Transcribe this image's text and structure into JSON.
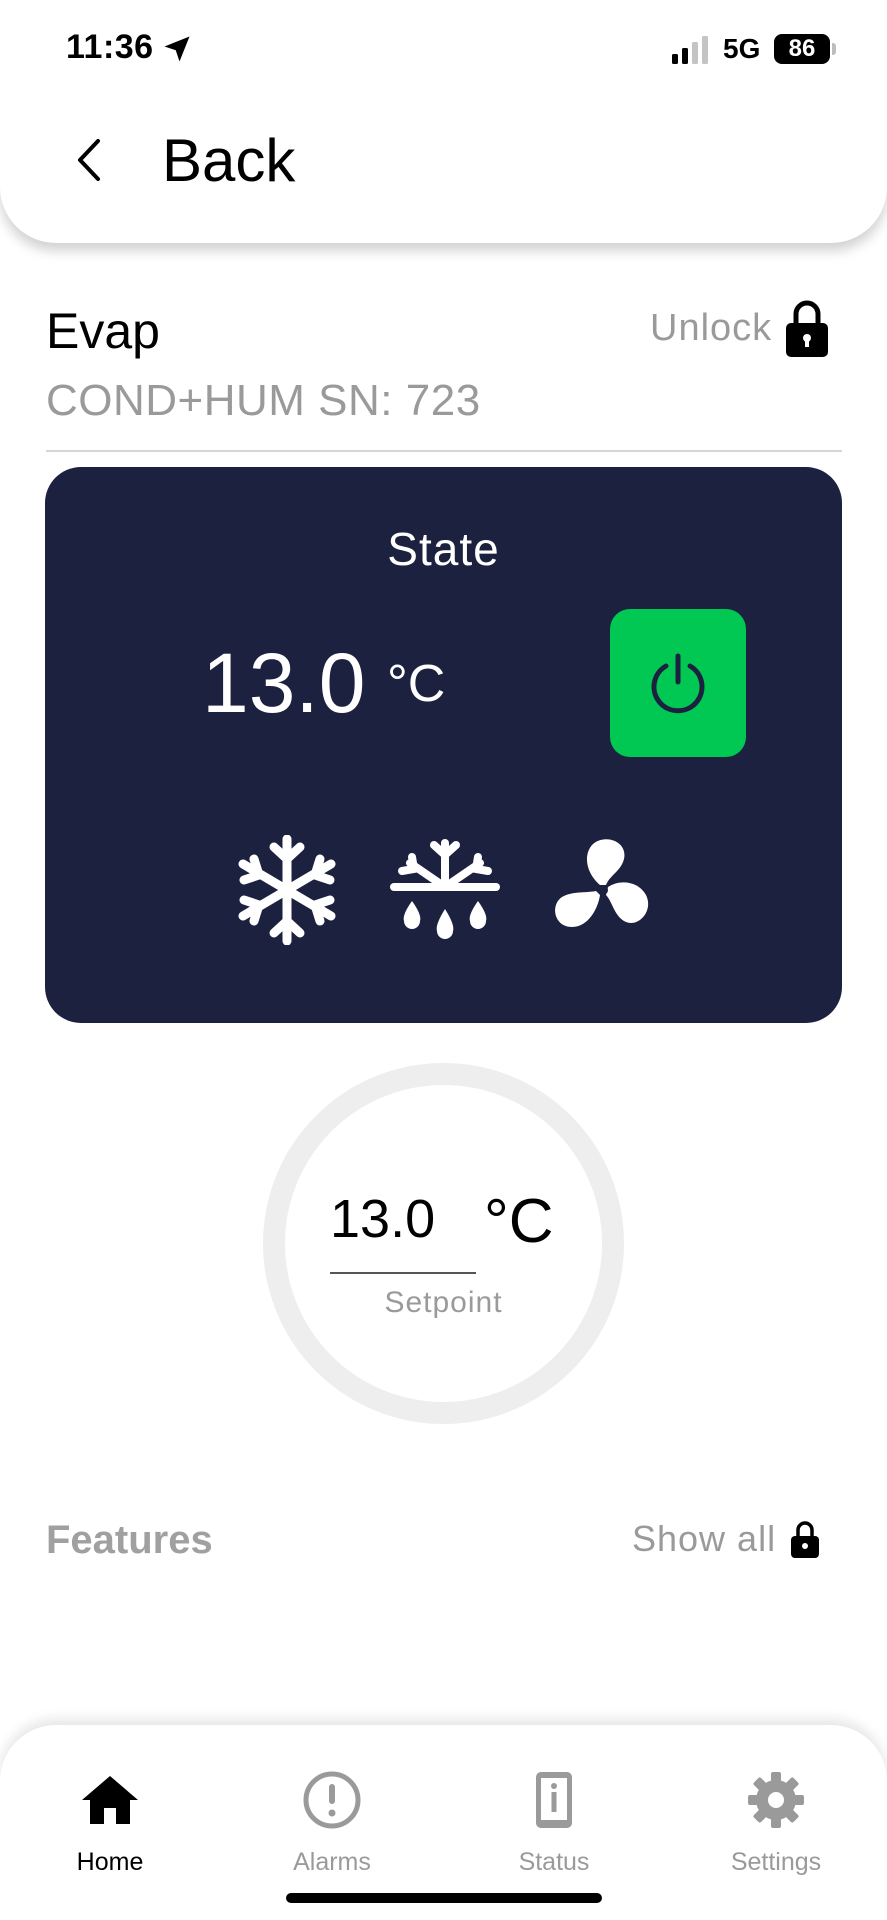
{
  "status_bar": {
    "time": "11:36",
    "network": "5G",
    "battery": "86"
  },
  "header": {
    "back_label": "Back"
  },
  "device": {
    "name": "Evap",
    "subtitle": "COND+HUM SN: 723",
    "unlock_label": "Unlock"
  },
  "state_card": {
    "title": "State",
    "temperature": "13.0",
    "unit": "°C",
    "power_color": "#00c853",
    "background": "#1d2140",
    "mode_icons": [
      "snowflake-icon",
      "defrost-drops-icon",
      "fan-icon"
    ]
  },
  "setpoint": {
    "value": "13.0",
    "unit": "°C",
    "label": "Setpoint"
  },
  "features": {
    "title": "Features",
    "show_all_label": "Show all"
  },
  "bottom_nav": {
    "items": [
      {
        "label": "Home",
        "icon": "home-icon",
        "active": true
      },
      {
        "label": "Alarms",
        "icon": "alert-icon",
        "active": false
      },
      {
        "label": "Status",
        "icon": "info-device-icon",
        "active": false
      },
      {
        "label": "Settings",
        "icon": "gear-icon",
        "active": false
      }
    ]
  }
}
